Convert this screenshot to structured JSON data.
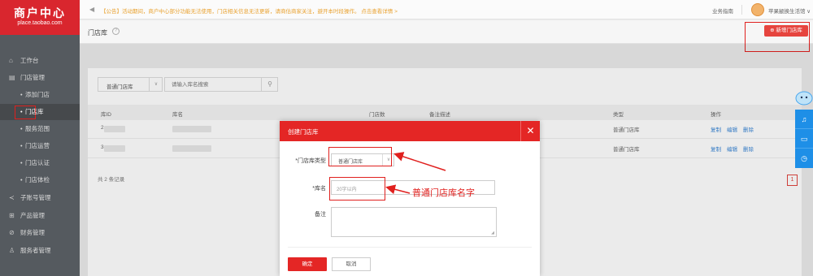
{
  "sidebar": {
    "logo_title": "商户中心",
    "logo_sub": "place.taobao.com",
    "items": [
      {
        "label": "工作台",
        "icon": "home-icon",
        "level": 1
      },
      {
        "label": "门店管理",
        "icon": "store-icon",
        "level": 1
      },
      {
        "label": "添加门店",
        "level": 2
      },
      {
        "label": "门店库",
        "level": 2,
        "active": true
      },
      {
        "label": "服务范围",
        "level": 2
      },
      {
        "label": "门店运营",
        "level": 2
      },
      {
        "label": "门店认证",
        "level": 2
      },
      {
        "label": "门店体检",
        "level": 2
      },
      {
        "label": "子账号管理",
        "icon": "share-icon",
        "level": 1
      },
      {
        "label": "产品管理",
        "icon": "grid-icon",
        "level": 1
      },
      {
        "label": "财务管理",
        "icon": "coin-icon",
        "level": 1
      },
      {
        "label": "服务者管理",
        "icon": "user-icon",
        "level": 1
      }
    ]
  },
  "notice": {
    "text": "【公告】活动期间，商户中心部分功能无法使用，门店相关信息无法更新，请商估商家关注，避开本时段操作。 点击查看详情 >",
    "guide": "业务指南",
    "username": "苹果颛换生活馆 ∨"
  },
  "header": {
    "title": "门店库",
    "help": "?",
    "new_button": "⊕ 新增门店库"
  },
  "filter": {
    "type_value": "普通门店库",
    "search_placeholder": "请输入库名搜索"
  },
  "table": {
    "columns": [
      "库ID",
      "库名",
      "门店数",
      "备注描述",
      "类型",
      "操作"
    ],
    "rows": [
      {
        "id": "2",
        "type": "普通门店库",
        "ops": [
          "复制",
          "编辑",
          "删除"
        ]
      },
      {
        "id": "3",
        "type": "普通门店库",
        "ops": [
          "复制",
          "编辑",
          "删除"
        ]
      }
    ],
    "total": "共 2 条记录",
    "page": "1"
  },
  "modal": {
    "title": "创建门店库",
    "close": "✕",
    "type_label": "*门店库类型",
    "type_value": "普通门店库",
    "name_label": "*库名",
    "name_placeholder": "20字以内",
    "remark_label": "备注",
    "ok": "确定",
    "cancel": "取消"
  },
  "annotation": {
    "text": "普通门店库名字",
    "color": "#e0201e"
  },
  "colors": {
    "brand_red": "#e42625",
    "sidebar": "#555a5f",
    "link_blue": "#3a86d6",
    "tool_blue": "#1e8fe7"
  }
}
